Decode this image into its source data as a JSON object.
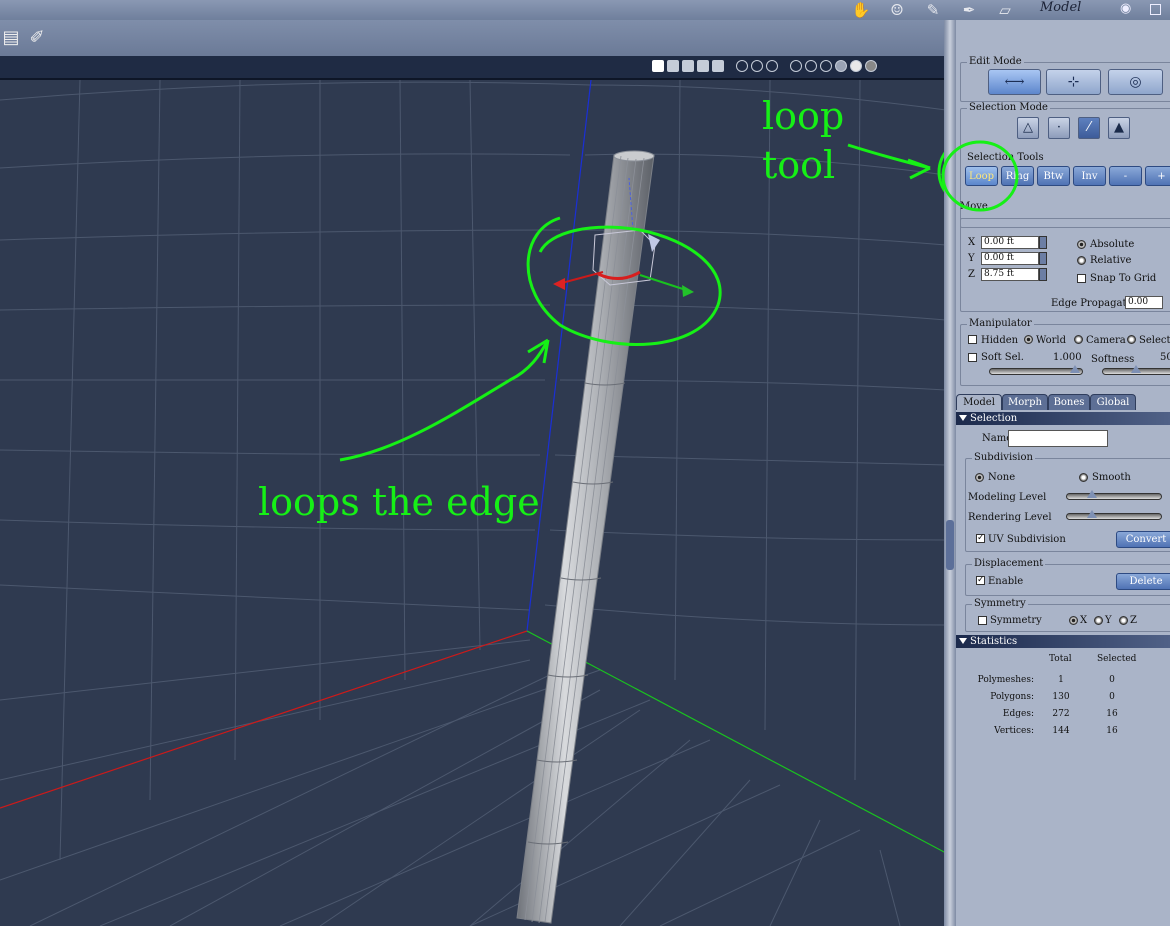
{
  "topbar": {
    "room": "Model"
  },
  "edit_mode": {
    "label": "Edit Mode"
  },
  "selection_mode": {
    "label": "Selection Mode"
  },
  "selection_tools": {
    "label": "Selection Tools",
    "buttons": [
      "Loop",
      "Ring",
      "Btw",
      "Inv",
      "-",
      "+"
    ]
  },
  "move": {
    "label": "Move",
    "x_label": "X",
    "y_label": "Y",
    "z_label": "Z",
    "x": "0.00 ft",
    "y": "0.00 ft",
    "z": "8.75 ft",
    "absolute": "Absolute",
    "relative": "Relative",
    "snap": "Snap To Grid",
    "edge_prop_label": "Edge Propagation",
    "edge_prop": "0.00"
  },
  "manipulator": {
    "label": "Manipulator",
    "hidden": "Hidden",
    "world": "World",
    "camera": "Camera",
    "selection": "Selection",
    "soft_sel": "Soft Sel.",
    "soft_val": "1.000",
    "softness": "Softness",
    "softness_val": "50"
  },
  "tabs": [
    "Model",
    "Morph",
    "Bones",
    "Global"
  ],
  "selection_section": {
    "title": "Selection",
    "name_label": "Name",
    "name_value": ""
  },
  "subdivision": {
    "label": "Subdivision",
    "none": "None",
    "smooth": "Smooth",
    "modeling": "Modeling Level",
    "rendering": "Rendering Level",
    "uv": "UV Subdivision",
    "convert": "Convert"
  },
  "displacement": {
    "label": "Displacement",
    "enable": "Enable",
    "delete": "Delete"
  },
  "symmetry": {
    "label": "Symmetry",
    "sym": "Symmetry",
    "x": "X",
    "y": "Y",
    "z": "Z"
  },
  "statistics": {
    "title": "Statistics",
    "col_total": "Total",
    "col_selected": "Selected",
    "rows": [
      {
        "label": "Polymeshes:",
        "total": "1",
        "selected": "0"
      },
      {
        "label": "Polygons:",
        "total": "130",
        "selected": "0"
      },
      {
        "label": "Edges:",
        "total": "272",
        "selected": "16"
      },
      {
        "label": "Vertices:",
        "total": "144",
        "selected": "16"
      }
    ]
  },
  "annotations": {
    "loop1": "loop",
    "loop2": "tool",
    "edge": "loops the edge",
    "color": "#16f016"
  },
  "colors": {
    "x_axis": "#cc1a1a",
    "y_axis": "#1a2fd6",
    "z_axis": "#19c21f",
    "viewport_bg": "#2f3a50"
  }
}
